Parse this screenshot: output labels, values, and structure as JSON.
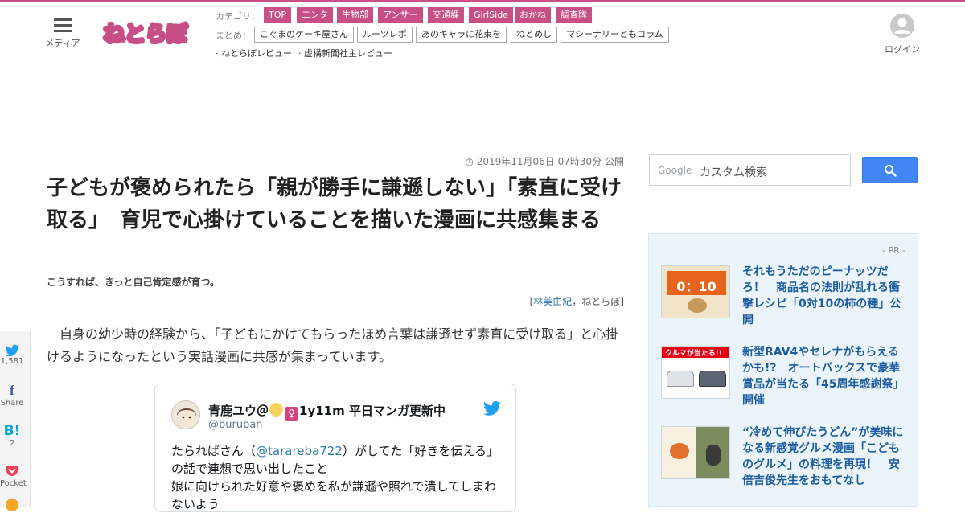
{
  "header": {
    "media_label": "メディア",
    "logo_text": "ねとらぼ",
    "category_label": "カテゴリ：",
    "categories": [
      "TOP",
      "エンタ",
      "生物部",
      "アンサー",
      "交通課",
      "GirlSide",
      "おかね",
      "調査隊"
    ],
    "matome_label": "まとめ：",
    "matome": [
      "こぐまのケーキ屋さん",
      "ルーツレポ",
      "あのキャラに花束を",
      "ねとめし",
      "マシーナリーともコラム"
    ],
    "extra_links": [
      "· ねとらぼレビュー",
      "· 虚構新聞社主レビュー"
    ],
    "login_label": "ログイン"
  },
  "article": {
    "date": "2019年11月06日 07時30分 公開",
    "title": "子どもが褒められたら「親が勝手に謙遜しない」「素直に受け取る」　育児で心掛けていることを描いた漫画に共感集まる",
    "subtitle": "こうすれば、きっと自己肯定感が育つ。",
    "byline_open": "[",
    "author": "林美由紀",
    "byline_sep": "，",
    "publisher": "ねとらぼ",
    "byline_close": "]",
    "lead": "　自身の幼少時の経験から、「子どもにかけてもらったほめ言葉は謙遜せず素直に受け取る」と心掛けるようになったという実話漫画に共感が集まっています。"
  },
  "share": {
    "twitter_count": "1,581",
    "facebook_label": "Share",
    "hatena_count": "2",
    "pocket_label": "Pocket"
  },
  "tweet": {
    "name_prefix": "青鹿ユウ＠",
    "name_suffix": "1y11m 平日マンガ更新中",
    "female_symbol": "♀",
    "handle": "@buruban",
    "text_1": "たらればさん（",
    "mention": "@tarareba722",
    "text_2": "）がしてた「好きを伝える」の話で連想で思い出したこと",
    "text_3": "娘に向けられた好意や褒めを私が謙遜や照れで潰してしまわないよう"
  },
  "sidebar": {
    "google_label": "Google",
    "search_placeholder": "カスタム検索",
    "pr_label": "- PR -",
    "thumb1_caption": "0：10",
    "thumb2_caption": "クルマが当たる!!",
    "pr_items": [
      "それもうただのピーナッツだろ！　商品名の法則が乱れる衝撃レシピ「0対10の柿の種」公開",
      "新型RAV4やセレナがもらえるかも!?　オートバックスで豪華賞品が当たる「45周年感謝祭」開催",
      "“冷めて伸びたうどん”が美味になる新感覚グルメ漫画「こどものグルメ」の料理を再現！　安倍吉俊先生をおもてなし"
    ]
  },
  "colors": {
    "brand": "#c84f86",
    "link": "#1d5ca3",
    "google_button": "#4285f4",
    "pr_background": "#eaf4fa"
  }
}
